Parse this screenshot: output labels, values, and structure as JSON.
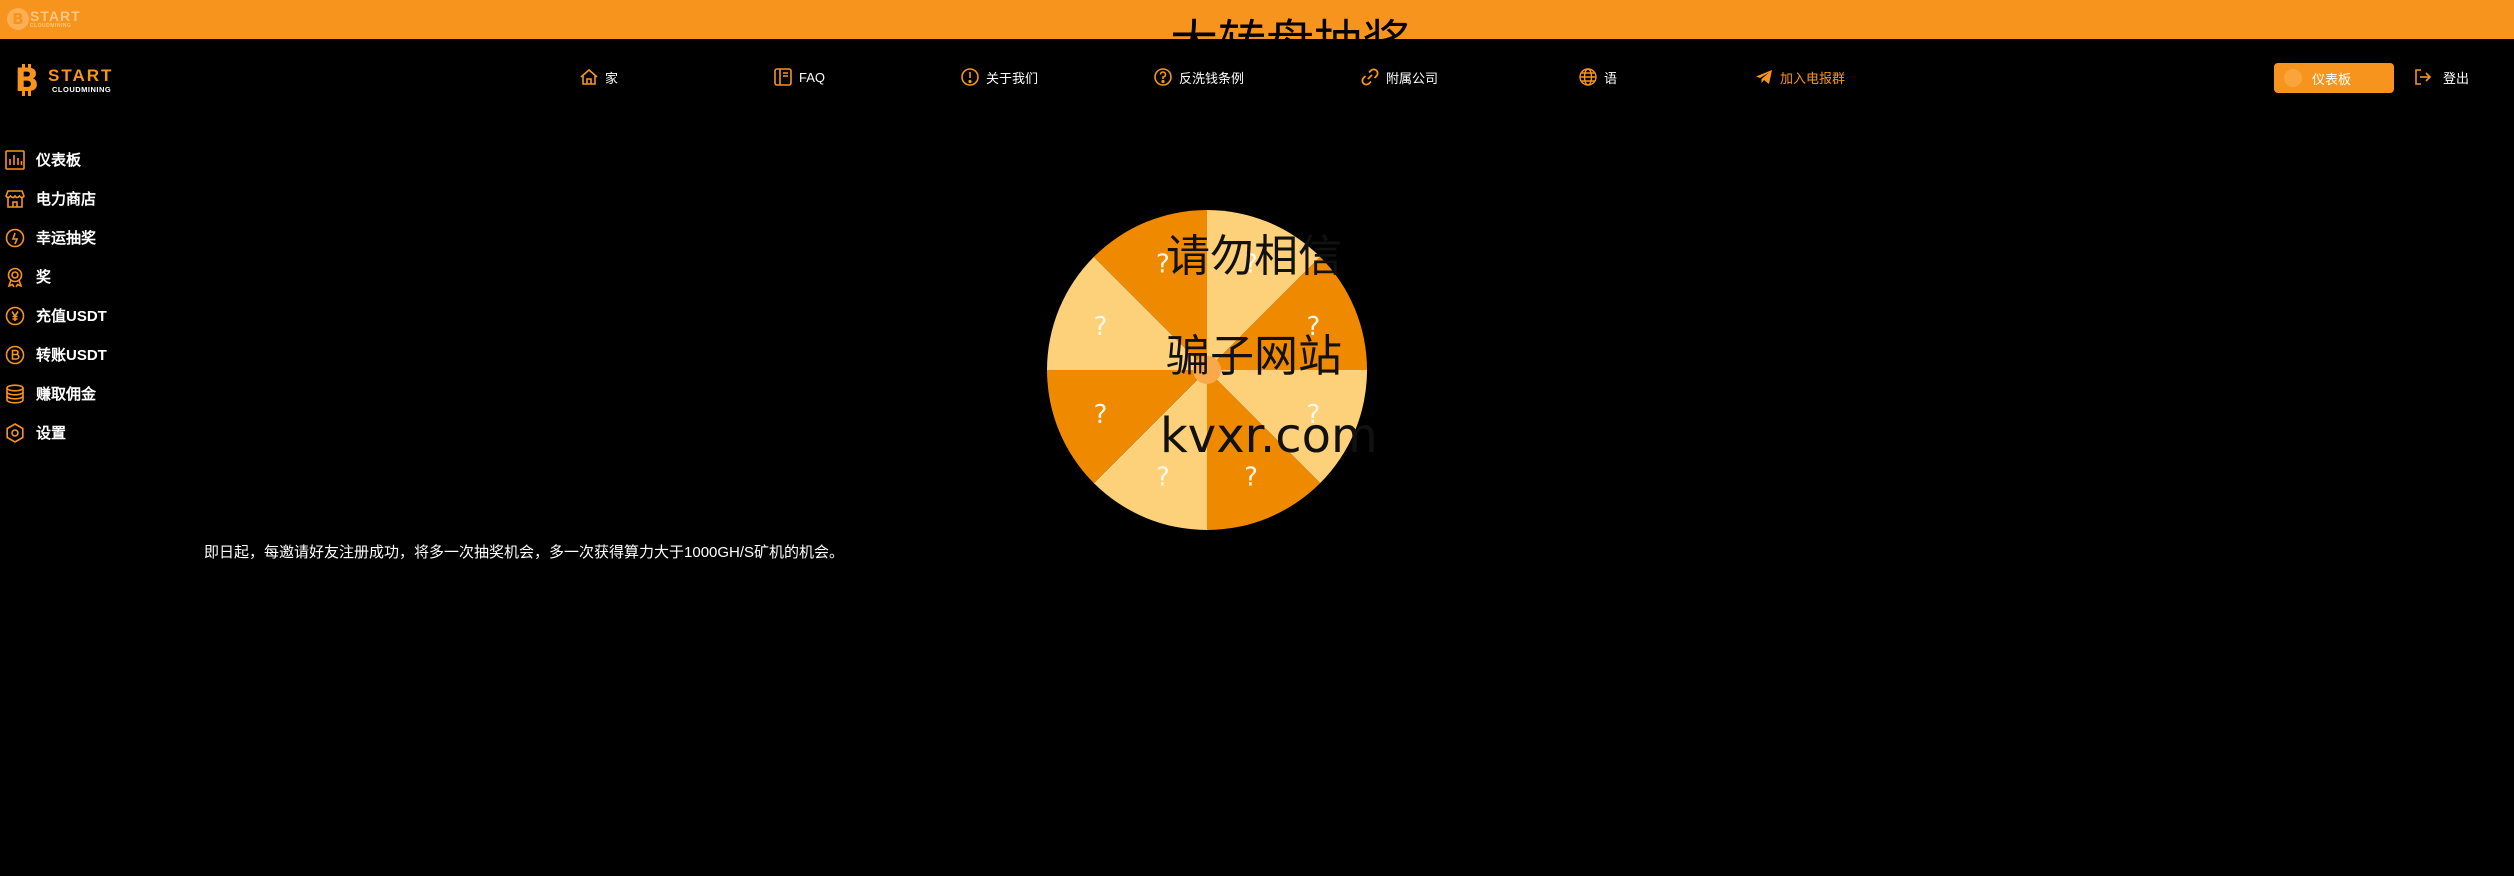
{
  "top_bar": {
    "mini_logo_word": "START",
    "mini_logo_sub": "CLOUDMINING",
    "ghost_title": "大转盘抽奖"
  },
  "brand": {
    "word": "START",
    "sub": "CLOUDMINING"
  },
  "nav": [
    {
      "label": "家",
      "icon": "home-icon"
    },
    {
      "label": "FAQ",
      "icon": "book-icon"
    },
    {
      "label": "关于我们",
      "icon": "info-icon"
    },
    {
      "label": "反洗钱条例",
      "icon": "question-icon"
    },
    {
      "label": "附属公司",
      "icon": "link-icon"
    },
    {
      "label": "语",
      "icon": "globe-icon"
    },
    {
      "label": "加入电报群",
      "icon": "telegram-icon"
    }
  ],
  "header_actions": {
    "dashboard_label": "仪表板",
    "logout_label": "登出"
  },
  "sidebar": {
    "items": [
      {
        "label": "仪表板",
        "icon": "chart-icon"
      },
      {
        "label": "电力商店",
        "icon": "store-icon"
      },
      {
        "label": "幸运抽奖",
        "icon": "lucky-icon"
      },
      {
        "label": "奖",
        "icon": "award-icon"
      },
      {
        "label": "充值USDT",
        "icon": "deposit-icon"
      },
      {
        "label": "转账USDT",
        "icon": "bitcoin-icon"
      },
      {
        "label": "赚取佣金",
        "icon": "coins-icon"
      },
      {
        "label": "设置",
        "icon": "settings-icon"
      }
    ]
  },
  "wheel": {
    "segments": 8,
    "prize_symbol": "?"
  },
  "overlay": {
    "line1": "请勿相信",
    "line2": "骗子网站",
    "line3": "kvxr.com"
  },
  "notice": "即日起，每邀请好友注册成功，将多一次抽奖机会，多一次获得算力大于1000GH/S矿机的机会。",
  "colors": {
    "accent": "#f7941d",
    "wheel_dark": "#ef8a00",
    "wheel_light": "#fdd07a",
    "background": "#000000"
  }
}
